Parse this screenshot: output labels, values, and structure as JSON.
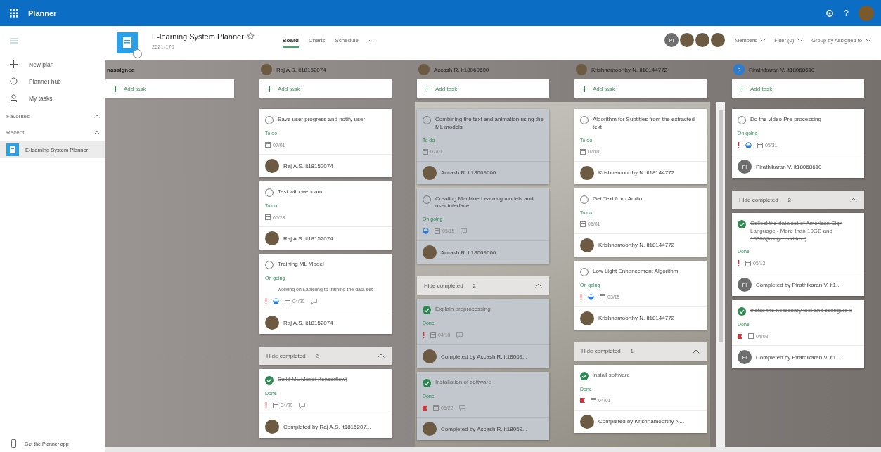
{
  "app_bar": {
    "title": "Planner",
    "help": "?"
  },
  "sidebar": {
    "items": [
      {
        "kind": "new",
        "label": "New plan"
      },
      {
        "kind": "hub",
        "label": "Planner hub"
      },
      {
        "kind": "mine",
        "label": "My tasks"
      }
    ],
    "sections": [
      {
        "label": "Favorites",
        "expanded": true
      },
      {
        "label": "Recent",
        "expanded": true,
        "items": [
          {
            "label": "E-learning System Planner",
            "selected": true
          }
        ]
      }
    ],
    "footer": "Get the Planner app"
  },
  "plan": {
    "title": "E-learning System Planner",
    "subtitle": "2021-170",
    "favorite": false,
    "tabs": [
      {
        "label": "Board",
        "selected": true
      },
      {
        "label": "Charts",
        "selected": false
      },
      {
        "label": "Schedule",
        "selected": false
      }
    ],
    "more": "···",
    "members": [
      {
        "kind": "initials",
        "text": "PI",
        "color": "#6e6e6e"
      },
      {
        "kind": "photo"
      },
      {
        "kind": "photo"
      },
      {
        "kind": "photo"
      }
    ],
    "actions": [
      "Members",
      "Filter (0)",
      "Group by Assigned to"
    ]
  },
  "columns": [
    {
      "name": "nassigned",
      "avatar": {
        "kind": "none"
      },
      "add_label": "Add task"
    },
    {
      "name": "Raj A.S. it18152074",
      "avatar": {
        "kind": "photo"
      },
      "add_label": "Add task",
      "tasks": [
        {
          "title": "Save user progress and notify user",
          "status": "To do",
          "due": "07/01",
          "important": false,
          "urgent": false,
          "progress": false,
          "comments": false,
          "completed": false,
          "assignee": "Raj A.S. it18152074",
          "avatar": {
            "kind": "photo"
          }
        },
        {
          "title": "Test with webcam",
          "status": "To do",
          "due": "05/23",
          "important": false,
          "urgent": false,
          "progress": false,
          "comments": false,
          "completed": false,
          "assignee": "Raj A.S. it18152074",
          "avatar": {
            "kind": "photo"
          }
        },
        {
          "title": "Training ML Model",
          "status": "On going",
          "note": "working on Lableling to training the data set",
          "due": "04/20",
          "important": true,
          "urgent": false,
          "progress": true,
          "comments": true,
          "completed": false,
          "assignee": "Raj A.S. it18152074",
          "avatar": {
            "kind": "photo"
          }
        }
      ],
      "completed_section": {
        "label": "Hide completed",
        "count": "2",
        "expanded": true,
        "tasks": [
          {
            "title": "Build ML Model (tensorflow)",
            "status": "Done",
            "due": "04/20",
            "important": true,
            "urgent": false,
            "progress": false,
            "comments": true,
            "completed": true,
            "assignee": "Completed by Raj A.S. it1815207...",
            "avatar": {
              "kind": "photo"
            }
          }
        ]
      }
    },
    {
      "name": "Accash R. it18069600",
      "avatar": {
        "kind": "photo"
      },
      "add_label": "Add task",
      "tinted": true,
      "tasks": [
        {
          "title": "Combining the text and animation using the ML models",
          "status": "To do",
          "due": "07/01",
          "important": false,
          "urgent": false,
          "progress": false,
          "comments": false,
          "completed": false,
          "assignee": "Accash R. it18069600",
          "avatar": {
            "kind": "photo"
          }
        },
        {
          "title": "Creating Machine Learning models and user interface",
          "status": "On going",
          "due": "05/15",
          "important": false,
          "urgent": false,
          "progress": true,
          "comments": true,
          "completed": false,
          "assignee": "Accash R. it18069600",
          "avatar": {
            "kind": "photo"
          }
        }
      ],
      "completed_section": {
        "label": "Hide completed",
        "count": "2",
        "expanded": true,
        "tasks": [
          {
            "title": "Explain preprocessing",
            "status": "Done",
            "due": "04/18",
            "important": true,
            "urgent": false,
            "progress": false,
            "comments": true,
            "completed": true,
            "assignee": "Completed by Accash R. it18069...",
            "avatar": {
              "kind": "photo"
            }
          },
          {
            "title": "Installation of software",
            "status": "Done",
            "due": "05/22",
            "important": false,
            "urgent": true,
            "progress": false,
            "comments": true,
            "completed": true,
            "assignee": "Completed by Accash R. it18069...",
            "avatar": {
              "kind": "photo"
            }
          }
        ]
      }
    },
    {
      "name": "Krishnamoorthy N. it18144772",
      "avatar": {
        "kind": "photo"
      },
      "add_label": "Add task",
      "scrollbar": true,
      "tasks": [
        {
          "title": "Algorithm for Subtitles from the extracted text",
          "status": "To do",
          "due": "07/01",
          "important": false,
          "urgent": false,
          "progress": false,
          "comments": false,
          "completed": false,
          "assignee": "Krishnamoorthy N. it18144772",
          "avatar": {
            "kind": "photo"
          }
        },
        {
          "title": "Get Text from Audio",
          "status": "To do",
          "due": "06/01",
          "important": false,
          "urgent": false,
          "progress": false,
          "comments": false,
          "completed": false,
          "assignee": "Krishnamoorthy N. it18144772",
          "avatar": {
            "kind": "photo"
          }
        },
        {
          "title": "Low Light Enhancement Algorithm",
          "status": "On going",
          "due": "03/15",
          "important": true,
          "urgent": false,
          "progress": true,
          "comments": false,
          "completed": false,
          "assignee": "Krishnamoorthy N. it18144772",
          "avatar": {
            "kind": "photo"
          }
        }
      ],
      "completed_section": {
        "label": "Hide completed",
        "count": "1",
        "expanded": true,
        "tasks": [
          {
            "title": "install software",
            "status": "Done",
            "due": "04/01",
            "important": false,
            "urgent": true,
            "progress": false,
            "comments": false,
            "completed": true,
            "assignee": "Completed by Krishnamoorthy N...",
            "avatar": {
              "kind": "photo"
            }
          }
        ]
      }
    },
    {
      "name": "Pirathikaran V. it18068610",
      "avatar": {
        "kind": "initials",
        "text": "R",
        "color": "#2b7cd3"
      },
      "add_label": "Add task",
      "tasks": [
        {
          "title": "Do the video Pre-processing",
          "status": "On going",
          "due": "05/31",
          "important": true,
          "urgent": false,
          "progress": true,
          "comments": false,
          "completed": false,
          "assignee": "Pirathikaran V. it18068610",
          "avatar": {
            "kind": "initials",
            "text": "PI",
            "color": "#6e6e6e"
          }
        }
      ],
      "completed_section": {
        "label": "Hide completed",
        "count": "2",
        "expanded": true,
        "tasks": [
          {
            "title": "Collect the data set of American Sign Language - More than 10GB and 15000(image and text)",
            "status": "Done",
            "due": "05/13",
            "important": true,
            "urgent": false,
            "progress": false,
            "comments": false,
            "completed": true,
            "assignee": "Completed by Pirathikaran V. it1...",
            "avatar": {
              "kind": "initials",
              "text": "PI",
              "color": "#6e6e6e"
            }
          },
          {
            "title": "Install the necessary tool and configure it",
            "status": "Done",
            "due": "04/02",
            "important": false,
            "urgent": true,
            "progress": false,
            "comments": false,
            "completed": true,
            "assignee": "Completed by Pirathikaran V. it1...",
            "avatar": {
              "kind": "initials",
              "text": "PI",
              "color": "#6e6e6e"
            }
          }
        ]
      }
    }
  ]
}
